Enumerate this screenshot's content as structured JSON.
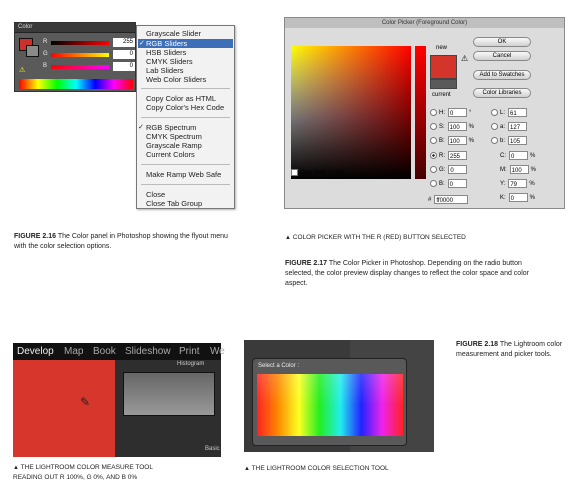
{
  "fig16": {
    "panel_tab": "Color",
    "sliders": [
      {
        "label": "R",
        "value": "255"
      },
      {
        "label": "G",
        "value": "0"
      },
      {
        "label": "B",
        "value": "0"
      }
    ],
    "menu": {
      "items": [
        {
          "label": "Grayscale Slider",
          "checked": false,
          "selected": false
        },
        {
          "label": "RGB Sliders",
          "checked": true,
          "selected": true
        },
        {
          "label": "HSB Sliders",
          "checked": false,
          "selected": false
        },
        {
          "label": "CMYK Sliders",
          "checked": false,
          "selected": false
        },
        {
          "label": "Lab Sliders",
          "checked": false,
          "selected": false
        },
        {
          "label": "Web Color Sliders",
          "checked": false,
          "selected": false
        },
        {
          "label": "Copy Color as HTML",
          "checked": false,
          "selected": false
        },
        {
          "label": "Copy Color's Hex Code",
          "checked": false,
          "selected": false
        },
        {
          "label": "RGB Spectrum",
          "checked": true,
          "selected": false
        },
        {
          "label": "CMYK Spectrum",
          "checked": false,
          "selected": false
        },
        {
          "label": "Grayscale Ramp",
          "checked": false,
          "selected": false
        },
        {
          "label": "Current Colors",
          "checked": false,
          "selected": false
        },
        {
          "label": "Make Ramp Web Safe",
          "checked": false,
          "selected": false
        },
        {
          "label": "Close",
          "checked": false,
          "selected": false
        },
        {
          "label": "Close Tab Group",
          "checked": false,
          "selected": false
        }
      ]
    },
    "caption_num": "FIGURE 2.16",
    "caption_text": "The Color panel in Photoshop showing the flyout menu with the color selection options."
  },
  "fig17": {
    "title": "Color Picker (Foreground Color)",
    "new_label": "new",
    "current_label": "current",
    "buttons": [
      "OK",
      "Cancel",
      "Add to Swatches",
      "Color Libraries"
    ],
    "only_web": "Only Web Colors",
    "fields_left": [
      {
        "label": "H:",
        "value": "0",
        "unit": "°"
      },
      {
        "label": "S:",
        "value": "100",
        "unit": "%"
      },
      {
        "label": "B:",
        "value": "100",
        "unit": "%"
      },
      {
        "label": "R:",
        "value": "255",
        "unit": ""
      },
      {
        "label": "G:",
        "value": "0",
        "unit": ""
      },
      {
        "label": "B:",
        "value": "0",
        "unit": ""
      }
    ],
    "fields_right": [
      {
        "label": "L:",
        "value": "61",
        "unit": ""
      },
      {
        "label": "a:",
        "value": "127",
        "unit": ""
      },
      {
        "label": "b:",
        "value": "105",
        "unit": ""
      },
      {
        "label": "C:",
        "value": "0",
        "unit": "%"
      },
      {
        "label": "M:",
        "value": "100",
        "unit": "%"
      },
      {
        "label": "Y:",
        "value": "79",
        "unit": "%"
      },
      {
        "label": "K:",
        "value": "0",
        "unit": "%"
      }
    ],
    "hex_label": "#",
    "hex": "ff0000",
    "sub_caption": "COLOR PICKER WITH THE R (RED) BUTTON SELECTED",
    "caption_num": "FIGURE 2.17",
    "caption_text": "The Color Picker in Photoshop. Depending on the radio button selected, the color preview display changes to reflect the color space and color aspect."
  },
  "fig18": {
    "caption_num": "FIGURE 2.18",
    "caption_text": "The Lightroom color measurement and picker tools.",
    "lr_nav": [
      "Develop",
      "Map",
      "Book",
      "Slideshow",
      "Print",
      "We"
    ],
    "histogram": "Histogram",
    "basic": "Basic",
    "lr_cap1": "THE LIGHTROOM COLOR MEASURE TOOL",
    "lr_cap2": "READING OUT R 100%, G 0%, AND B 0%",
    "select_color": "Select a Color :",
    "sel_cap": "THE LIGHTROOM COLOR SELECTION TOOL"
  }
}
